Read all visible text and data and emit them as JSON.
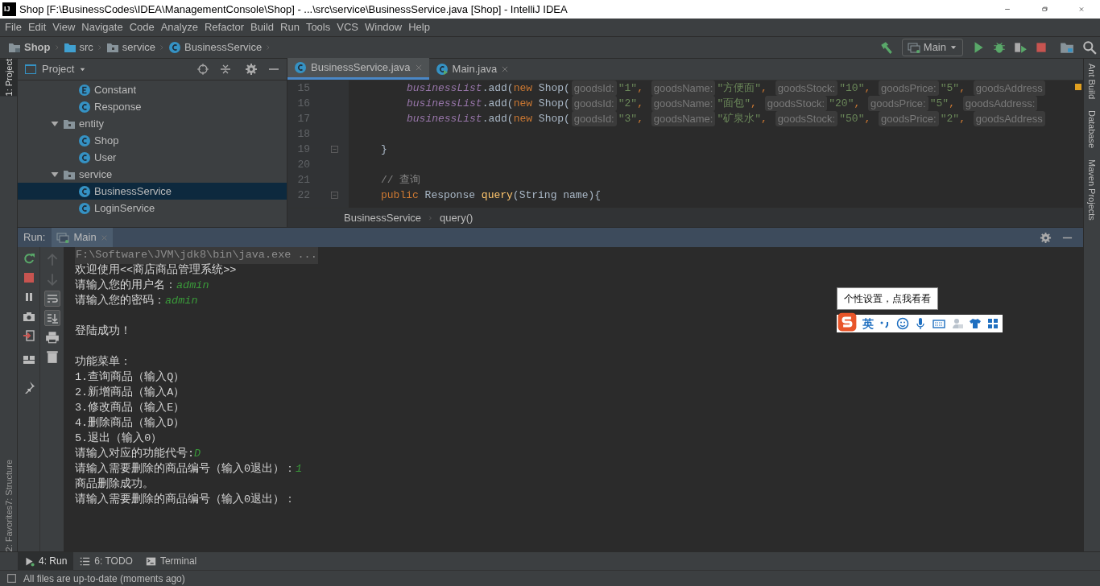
{
  "window": {
    "logo": "IJ",
    "title": "Shop [F:\\BusinessCodes\\IDEA\\ManagementConsole\\Shop] - ...\\src\\service\\BusinessService.java [Shop] - IntelliJ IDEA"
  },
  "menu": [
    "File",
    "Edit",
    "View",
    "Navigate",
    "Code",
    "Analyze",
    "Refactor",
    "Build",
    "Run",
    "Tools",
    "VCS",
    "Window",
    "Help"
  ],
  "breadcrumb": [
    {
      "label": "Shop",
      "kind": "project"
    },
    {
      "label": "src",
      "kind": "folder"
    },
    {
      "label": "service",
      "kind": "package"
    },
    {
      "label": "BusinessService",
      "kind": "class"
    }
  ],
  "run_config": "Main",
  "left_strip": [
    {
      "label": "1: Project",
      "selected": true
    },
    {
      "label": "7: Structure",
      "selected": false
    },
    {
      "label": "2: Favorites",
      "selected": false
    }
  ],
  "right_strip": [
    "Ant Build",
    "Database",
    "Maven Projects"
  ],
  "project_panel": {
    "title": "Project",
    "tree": [
      {
        "label": "Constant",
        "kind": "enum"
      },
      {
        "label": "Response",
        "kind": "class"
      },
      {
        "label": "entity",
        "kind": "package",
        "expanded": true,
        "selected": false,
        "children": [
          {
            "label": "Shop",
            "kind": "class",
            "selected": false
          },
          {
            "label": "User",
            "kind": "class",
            "selected": false
          }
        ]
      },
      {
        "label": "service",
        "kind": "package",
        "expanded": true,
        "selected": false,
        "children": [
          {
            "label": "BusinessService",
            "kind": "class",
            "selected": true
          },
          {
            "label": "LoginService",
            "kind": "class",
            "selected": false
          }
        ]
      }
    ]
  },
  "editor": {
    "tabs": [
      {
        "label": "BusinessService.java",
        "kind": "class",
        "selected": true
      },
      {
        "label": "Main.java",
        "kind": "main",
        "selected": false
      }
    ],
    "lines": [
      {
        "number": "15",
        "kind": "nested",
        "fold": false,
        "tokens": [
          {
            "kind": "field",
            "text": "businessList"
          },
          {
            "kind": "plain",
            "text": ".add("
          },
          {
            "kind": "keyword",
            "text": "new"
          },
          {
            "kind": "plain",
            "text": " Shop("
          },
          {
            "kind": "hint",
            "text": "goodsId:"
          },
          {
            "kind": "string",
            "text": "\"1\""
          },
          {
            "kind": "punct",
            "text": ", "
          },
          {
            "kind": "hint",
            "text": "goodsName:"
          },
          {
            "kind": "string",
            "text": "\"方便面\""
          },
          {
            "kind": "punct",
            "text": ", "
          },
          {
            "kind": "hint",
            "text": "goodsStock:"
          },
          {
            "kind": "string",
            "text": "\"10\""
          },
          {
            "kind": "punct",
            "text": ", "
          },
          {
            "kind": "hint",
            "text": "goodsPrice:"
          },
          {
            "kind": "string",
            "text": "\"5\""
          },
          {
            "kind": "punct",
            "text": ", "
          },
          {
            "kind": "hint",
            "text": "goodsAddress"
          }
        ]
      },
      {
        "number": "16",
        "kind": "nested",
        "fold": false,
        "tokens": [
          {
            "kind": "field",
            "text": "businessList"
          },
          {
            "kind": "plain",
            "text": ".add("
          },
          {
            "kind": "keyword",
            "text": "new"
          },
          {
            "kind": "plain",
            "text": " Shop("
          },
          {
            "kind": "hint",
            "text": "goodsId:"
          },
          {
            "kind": "string",
            "text": "\"2\""
          },
          {
            "kind": "punct",
            "text": ", "
          },
          {
            "kind": "hint",
            "text": "goodsName:"
          },
          {
            "kind": "string",
            "text": "\"面包\""
          },
          {
            "kind": "punct",
            "text": ", "
          },
          {
            "kind": "hint",
            "text": "goodsStock:"
          },
          {
            "kind": "string",
            "text": "\"20\""
          },
          {
            "kind": "punct",
            "text": ", "
          },
          {
            "kind": "hint",
            "text": "goodsPrice:"
          },
          {
            "kind": "string",
            "text": "\"5\""
          },
          {
            "kind": "punct",
            "text": ", "
          },
          {
            "kind": "hint",
            "text": "goodsAddress:"
          }
        ]
      },
      {
        "number": "17",
        "kind": "nested",
        "fold": false,
        "tokens": [
          {
            "kind": "field",
            "text": "businessList"
          },
          {
            "kind": "plain",
            "text": ".add("
          },
          {
            "kind": "keyword",
            "text": "new"
          },
          {
            "kind": "plain",
            "text": " Shop("
          },
          {
            "kind": "hint",
            "text": "goodsId:"
          },
          {
            "kind": "string",
            "text": "\"3\""
          },
          {
            "kind": "punct",
            "text": ", "
          },
          {
            "kind": "hint",
            "text": "goodsName:"
          },
          {
            "kind": "string",
            "text": "\"矿泉水\""
          },
          {
            "kind": "punct",
            "text": ", "
          },
          {
            "kind": "hint",
            "text": "goodsStock:"
          },
          {
            "kind": "string",
            "text": "\"50\""
          },
          {
            "kind": "punct",
            "text": ", "
          },
          {
            "kind": "hint",
            "text": "goodsPrice:"
          },
          {
            "kind": "string",
            "text": "\"2\""
          },
          {
            "kind": "punct",
            "text": ", "
          },
          {
            "kind": "hint",
            "text": "goodsAddress"
          }
        ]
      },
      {
        "number": "18",
        "kind": "blank",
        "fold": false
      },
      {
        "number": "19",
        "kind": "member",
        "fold": true,
        "tokens": [
          {
            "kind": "plain",
            "text": "}"
          }
        ]
      },
      {
        "number": "20",
        "kind": "blank",
        "fold": false
      },
      {
        "number": "21",
        "kind": "member",
        "fold": false,
        "tokens": [
          {
            "kind": "comment",
            "text": "// 查询"
          }
        ]
      },
      {
        "number": "22",
        "kind": "member",
        "fold": true,
        "tokens": [
          {
            "kind": "keyword",
            "text": "public"
          },
          {
            "kind": "plain",
            "text": " Response "
          },
          {
            "kind": "method",
            "text": "query"
          },
          {
            "kind": "plain",
            "text": "(String name){"
          }
        ]
      }
    ],
    "path": [
      "BusinessService",
      "query()"
    ]
  },
  "run_panel": {
    "label": "Run:",
    "tab": "Main",
    "console": [
      {
        "kind": "command",
        "text": "F:\\Software\\JVM\\jdk8\\bin\\java.exe ..."
      },
      {
        "kind": "output",
        "text": "欢迎使用<<商店商品管理系统>>"
      },
      {
        "kind": "output",
        "text": "请输入您的用户名：",
        "input": "admin"
      },
      {
        "kind": "output",
        "text": "请输入您的密码：",
        "input": "admin"
      },
      {
        "kind": "blank"
      },
      {
        "kind": "output",
        "text": "登陆成功！"
      },
      {
        "kind": "blank"
      },
      {
        "kind": "output",
        "text": "功能菜单："
      },
      {
        "kind": "output",
        "text": "1.查询商品（输入Q）"
      },
      {
        "kind": "output",
        "text": "2.新增商品（输入A）"
      },
      {
        "kind": "output",
        "text": "3.修改商品（输入E）"
      },
      {
        "kind": "output",
        "text": "4.删除商品（输入D）"
      },
      {
        "kind": "output",
        "text": "5.退出（输入0）"
      },
      {
        "kind": "output",
        "text": "请输入对应的功能代号:",
        "input": "D"
      },
      {
        "kind": "output",
        "text": "请输入需要删除的商品编号（输入0退出）：",
        "input": "1"
      },
      {
        "kind": "output",
        "text": "商品删除成功。"
      },
      {
        "kind": "output",
        "text": "请输入需要删除的商品编号（输入0退出）："
      }
    ]
  },
  "ime": {
    "tooltip": "个性设置，点我看看",
    "mode": "英"
  },
  "bottom_tabs": [
    {
      "label": "4: Run",
      "kind": "run",
      "selected": true
    },
    {
      "label": "6: TODO",
      "kind": "todo",
      "selected": false
    },
    {
      "label": "Terminal",
      "kind": "terminal",
      "selected": false
    }
  ],
  "status_bar": "All files are up-to-date (moments ago)"
}
